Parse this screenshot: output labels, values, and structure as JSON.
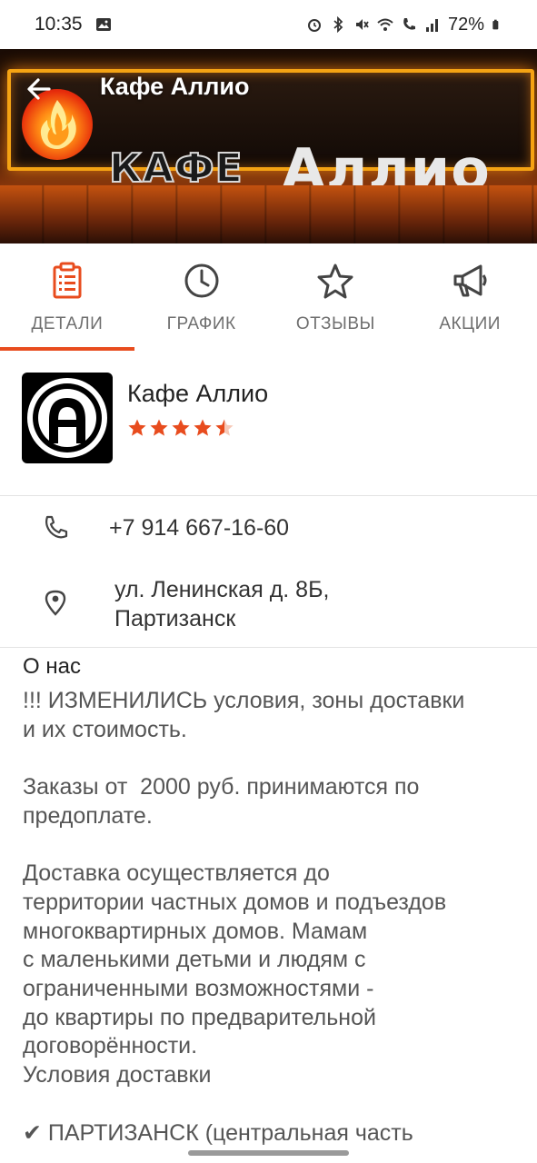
{
  "status_bar": {
    "time": "10:35",
    "battery": "72%",
    "icons": [
      "image-icon",
      "alarm-icon",
      "bluetooth-icon",
      "mute-icon",
      "wifi-icon",
      "call-icon",
      "signal-icon",
      "battery-icon"
    ]
  },
  "header": {
    "title": "Кафе Аллио",
    "banner_text_small": "КАФЕ",
    "banner_text_large": "Аллио",
    "back_icon": "arrow-back-icon"
  },
  "tabs": [
    {
      "label": "ДЕТАЛИ",
      "icon": "clipboard-list-icon",
      "active": true
    },
    {
      "label": "ГРАФИК",
      "icon": "clock-icon",
      "active": false
    },
    {
      "label": "ОТЗЫВЫ",
      "icon": "star-outline-icon",
      "active": false
    },
    {
      "label": "АКЦИИ",
      "icon": "megaphone-icon",
      "active": false
    }
  ],
  "profile": {
    "name": "Кафе Аллио",
    "rating": 4.5,
    "rating_max": 5
  },
  "contacts": {
    "phone": "+7 914 667-16-60",
    "address_line1": "ул. Ленинская д. 8Б,",
    "address_line2": "Партизанск"
  },
  "about": {
    "title": "О нас",
    "body": "!!! ИЗМЕНИЛИСЬ условия, зоны доставки\nи их стоимость.\n\nЗаказы от  2000 руб. принимаются по\nпредоплате.\n\nДоставка осуществляется до\nтерритории частных домов и подъездов\nмногоквартирных домов. Мамам\nс маленькими детьми и людям с\nограниченными возможностями -\nдо квартиры по предварительной\nдоговорённости.\nУсловия доставки\n\n✔ ПАРТИЗАНСК (центральная часть"
  },
  "colors": {
    "accent": "#e84c1e",
    "star": "#e84c1e",
    "tab_text": "#6f6f6f"
  }
}
